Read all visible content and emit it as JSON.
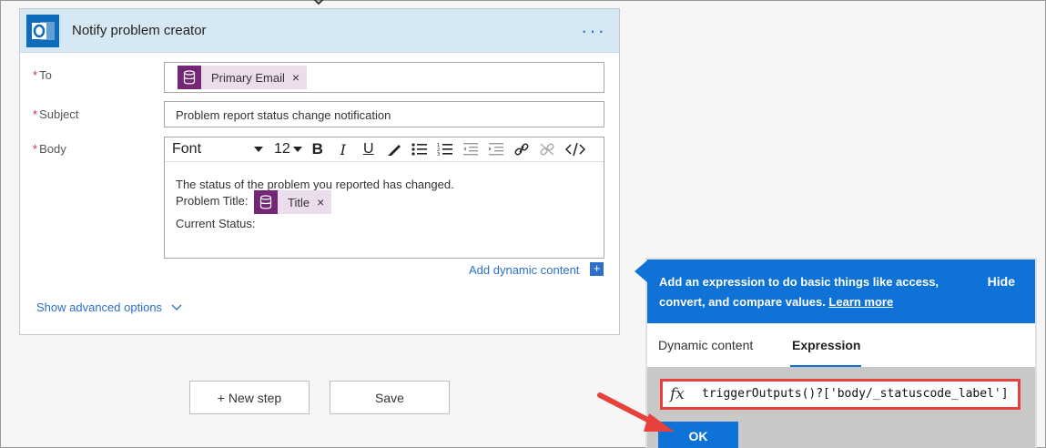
{
  "action": {
    "title": "Notify problem creator",
    "more_label": "···",
    "app_icon": "outlook-icon"
  },
  "fields": {
    "to": {
      "label": "To",
      "required_mark": "*",
      "token": {
        "label": "Primary Email",
        "remove": "×",
        "icon": "database-icon"
      }
    },
    "subject": {
      "label": "Subject",
      "required_mark": "*",
      "value": "Problem report status change notification"
    },
    "body": {
      "label": "Body",
      "required_mark": "*",
      "toolbar": {
        "font": "Font",
        "size": "12",
        "bold": "B",
        "italic": "I",
        "underline": "U"
      },
      "line1": "The status of the problem you reported has changed.",
      "line2_prefix": "Problem Title:",
      "title_token": {
        "label": "Title",
        "remove": "×",
        "icon": "database-icon"
      },
      "line3": "Current Status:"
    }
  },
  "add_dynamic_content": "Add dynamic content",
  "add_dynamic_plus": "+",
  "show_advanced": "Show advanced options",
  "buttons": {
    "new_step": "+ New step",
    "save": "Save"
  },
  "expression_panel": {
    "description": "Add an expression to do basic things like access, convert, and compare values.",
    "learn_more": "Learn more",
    "hide": "Hide",
    "tabs": [
      "Dynamic content",
      "Expression"
    ],
    "active_tab": "Expression",
    "fx": "fx",
    "expression": "triggerOutputs()?['body/_statuscode_label']",
    "ok": "OK"
  },
  "colors": {
    "header_bg": "#d7e8f5",
    "accent": "#0f72d6",
    "token_bg": "#ecdded",
    "token_icon": "#742774",
    "highlight": "#e8403c"
  }
}
